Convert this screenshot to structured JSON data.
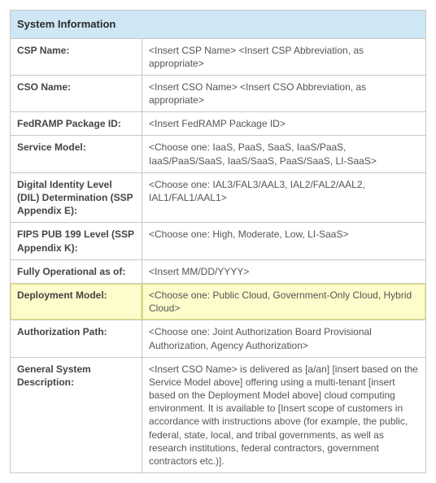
{
  "title": "System Information",
  "rows": [
    {
      "label": "CSP Name:",
      "value": "<Insert CSP Name> <Insert CSP Abbreviation, as appropriate>",
      "highlight": false
    },
    {
      "label": "CSO Name:",
      "value": "<Insert CSO Name> <Insert CSO Abbreviation, as appropriate>",
      "highlight": false
    },
    {
      "label": "FedRAMP Package ID:",
      "value": "<Insert FedRAMP Package ID>",
      "highlight": false
    },
    {
      "label": "Service Model:",
      "value": "<Choose one: IaaS, PaaS, SaaS, IaaS/PaaS, IaaS/PaaS/SaaS, IaaS/SaaS, PaaS/SaaS, LI-SaaS>",
      "highlight": false
    },
    {
      "label": "Digital Identity Level (DIL) Determination (SSP Appendix E):",
      "value": "<Choose one: IAL3/FAL3/AAL3, IAL2/FAL2/AAL2, IAL1/FAL1/AAL1>",
      "highlight": false
    },
    {
      "label": "FIPS PUB 199 Level (SSP Appendix K):",
      "value": "<Choose one: High, Moderate, Low, LI-SaaS>",
      "highlight": false
    },
    {
      "label": "Fully Operational as of:",
      "value": "<Insert MM/DD/YYYY>",
      "highlight": false
    },
    {
      "label": "Deployment Model:",
      "value": "<Choose one: Public Cloud, Government-Only Cloud, Hybrid Cloud>",
      "highlight": true
    },
    {
      "label": "Authorization Path:",
      "value": "<Choose one: Joint Authorization Board Provisional Authorization, Agency Authorization>",
      "highlight": false
    },
    {
      "label": "General System Description:",
      "value": "<Insert CSO Name> is delivered as [a/an] [insert based on the Service Model above] offering using a multi-tenant [insert based on the Deployment Model above] cloud computing environment. It is available to [Insert scope of customers in accordance with instructions above (for example, the public, federal, state, local, and tribal governments, as well as research institutions, federal contractors, government contractors etc.)].",
      "highlight": false
    }
  ]
}
